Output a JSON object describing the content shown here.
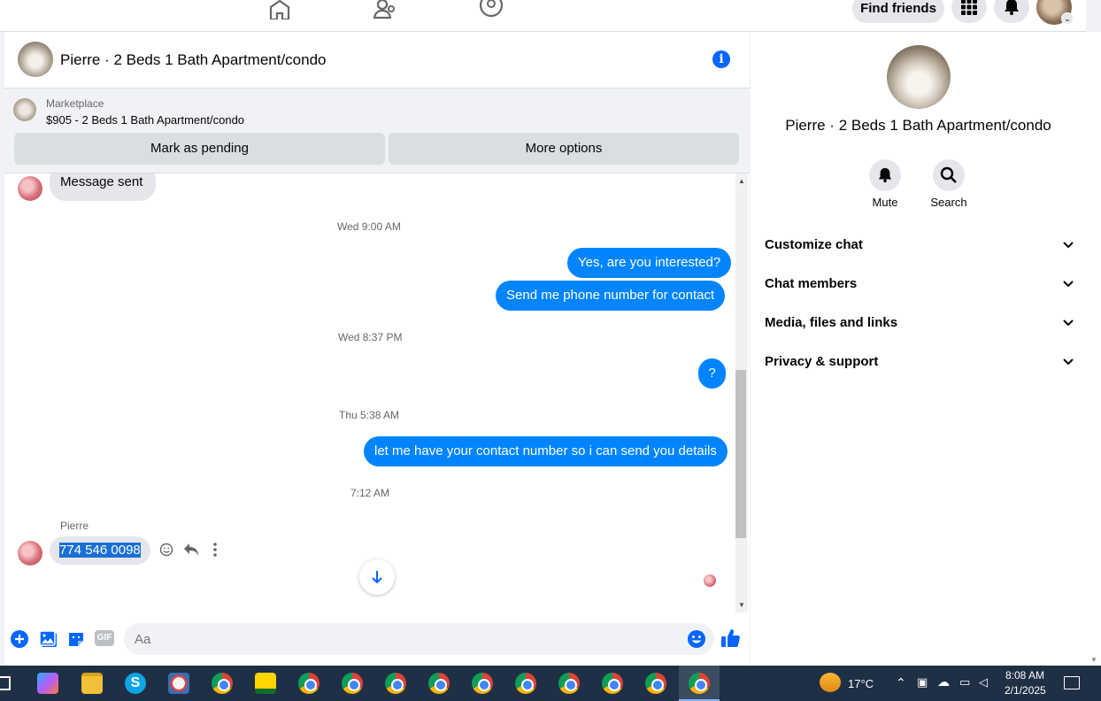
{
  "topnav": {
    "find_friends": "Find friends"
  },
  "chat": {
    "header_title": "Pierre · 2 Beds 1 Bath Apartment/condo",
    "marketplace": {
      "label": "Marketplace",
      "listing": "$905 - 2 Beds 1 Bath Apartment/condo",
      "mark_pending": "Mark as pending",
      "more_options": "More options"
    },
    "messages": {
      "sent_text": "Message sent",
      "time1": "Wed 9:00 AM",
      "out1": "Yes, are you interested?",
      "out2": "Send me phone number for contact",
      "time2": "Wed 8:37 PM",
      "out3": "?",
      "time3": "Thu 5:38 AM",
      "out4": "let me have your contact number so i can send you details",
      "time4": "7:12 AM",
      "sender_name": "Pierre",
      "in_phone": "774 546 0098"
    },
    "composer": {
      "placeholder": "Aa",
      "gif_label": "GIF"
    }
  },
  "info_panel": {
    "title": "Pierre · 2 Beds 1 Bath Apartment/condo",
    "mute_label": "Mute",
    "search_label": "Search",
    "rows": [
      "Customize chat",
      "Chat members",
      "Media, files and links",
      "Privacy & support"
    ]
  },
  "taskbar": {
    "temperature": "17°C",
    "time": "8:08 AM",
    "date": "2/1/2025"
  },
  "colors": {
    "accent": "#0084ff",
    "brand_blue": "#0866ff",
    "taskbar_bg": "#1f2f45"
  }
}
